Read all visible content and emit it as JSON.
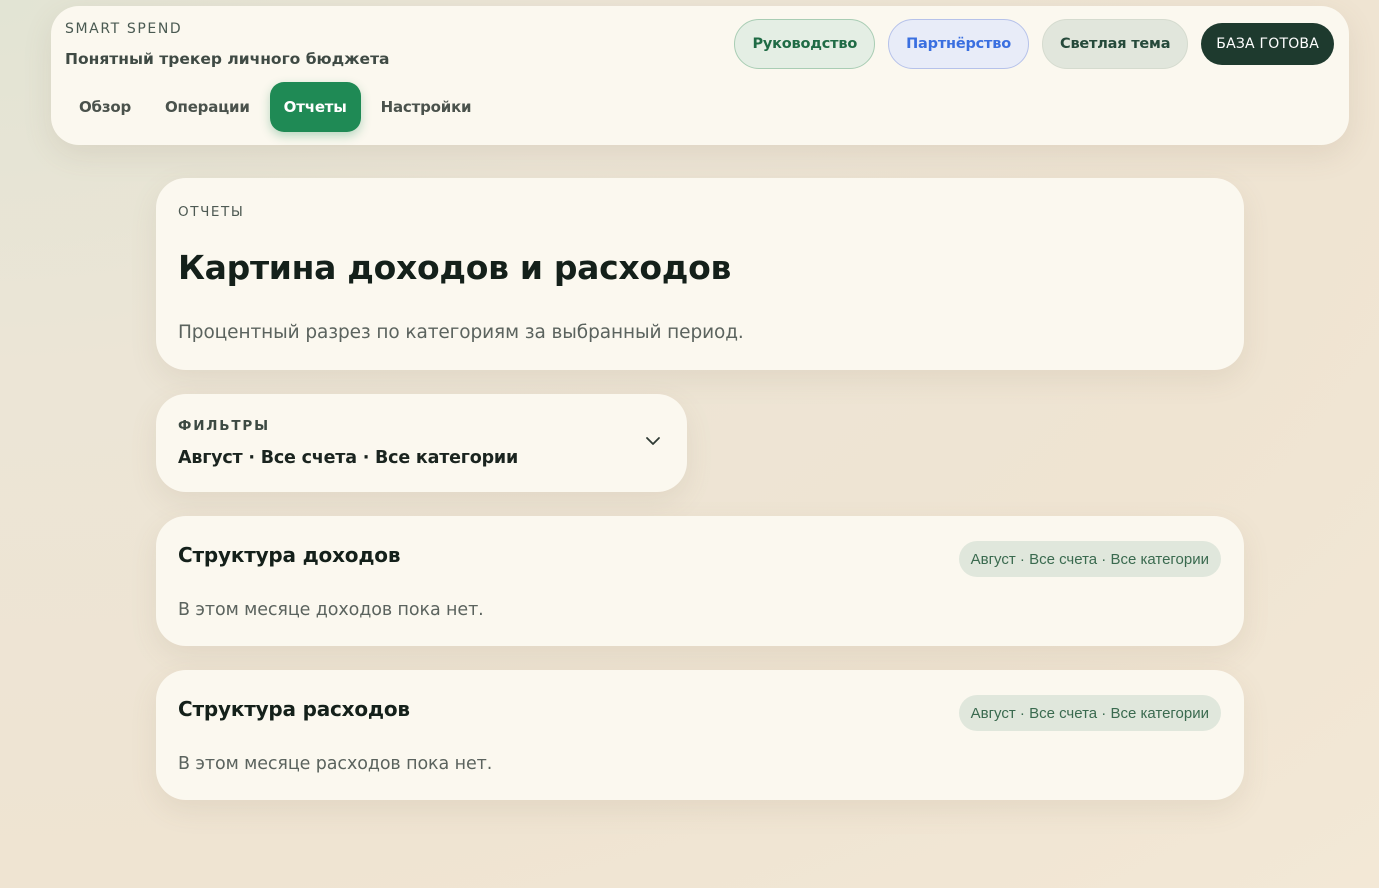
{
  "header": {
    "brand": "SMART SPEND",
    "tagline": "Понятный трекер личного бюджета",
    "tabs": [
      {
        "label": "Обзор",
        "active": false
      },
      {
        "label": "Операции",
        "active": false
      },
      {
        "label": "Отчеты",
        "active": true
      },
      {
        "label": "Настройки",
        "active": false
      }
    ],
    "actions": {
      "guide": "Руководство",
      "partnership": "Партнёрство",
      "theme": "Светлая тема",
      "status": "БАЗА ГОТОВА"
    }
  },
  "hero": {
    "eyebrow": "ОТЧЕТЫ",
    "title": "Картина доходов и расходов",
    "subtitle": "Процентный разрез по категориям за выбранный период."
  },
  "filters": {
    "label": "ФИЛЬТРЫ",
    "summary": "Август · Все счета · Все категории"
  },
  "income": {
    "title": "Структура доходов",
    "badge": "Август · Все счета · Все категории",
    "empty": "В этом месяце доходов пока нет."
  },
  "expense": {
    "title": "Структура расходов",
    "badge": "Август · Все счета · Все категории",
    "empty": "В этом месяце расходов пока нет."
  },
  "colors": {
    "accent": "#1f8a55",
    "status_bg": "#1e3a2e",
    "partner_text": "#3a6fe0",
    "card_bg": "#fbf8ef"
  }
}
